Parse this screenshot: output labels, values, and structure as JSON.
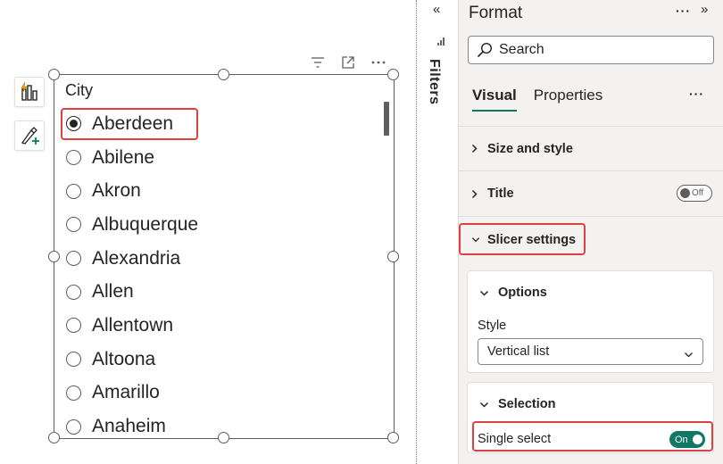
{
  "slicer": {
    "title": "City",
    "cities": [
      "Aberdeen",
      "Abilene",
      "Akron",
      "Albuquerque",
      "Alexandria",
      "Allen",
      "Allentown",
      "Altoona",
      "Amarillo",
      "Anaheim"
    ],
    "selected": "Aberdeen"
  },
  "filters": {
    "label": "Filters"
  },
  "format_pane": {
    "title": "Format",
    "more": "···",
    "search": {
      "placeholder": "Search",
      "value": ""
    },
    "tabs": [
      {
        "label": "Visual",
        "active": true
      },
      {
        "label": "Properties",
        "active": false
      }
    ],
    "tab_more": "···",
    "sections": {
      "size_style": "Size and style",
      "title": "Title",
      "title_toggle": "Off",
      "slicer_settings": "Slicer settings"
    },
    "options": {
      "header": "Options",
      "style_label": "Style",
      "style_value": "Vertical list"
    },
    "selection": {
      "header": "Selection",
      "single_select_label": "Single select",
      "single_select_toggle": "On"
    }
  },
  "colors": {
    "accent": "#117865",
    "highlight": "#e0403f",
    "pane_bg": "#f3f2f1"
  },
  "icons": [
    "build-visual-icon",
    "format-visual-icon",
    "filter-icon",
    "focus-mode-icon",
    "more-options-icon",
    "collapse-icon",
    "expand-icon",
    "search-icon",
    "chevron-right-icon",
    "chevron-down-icon"
  ]
}
